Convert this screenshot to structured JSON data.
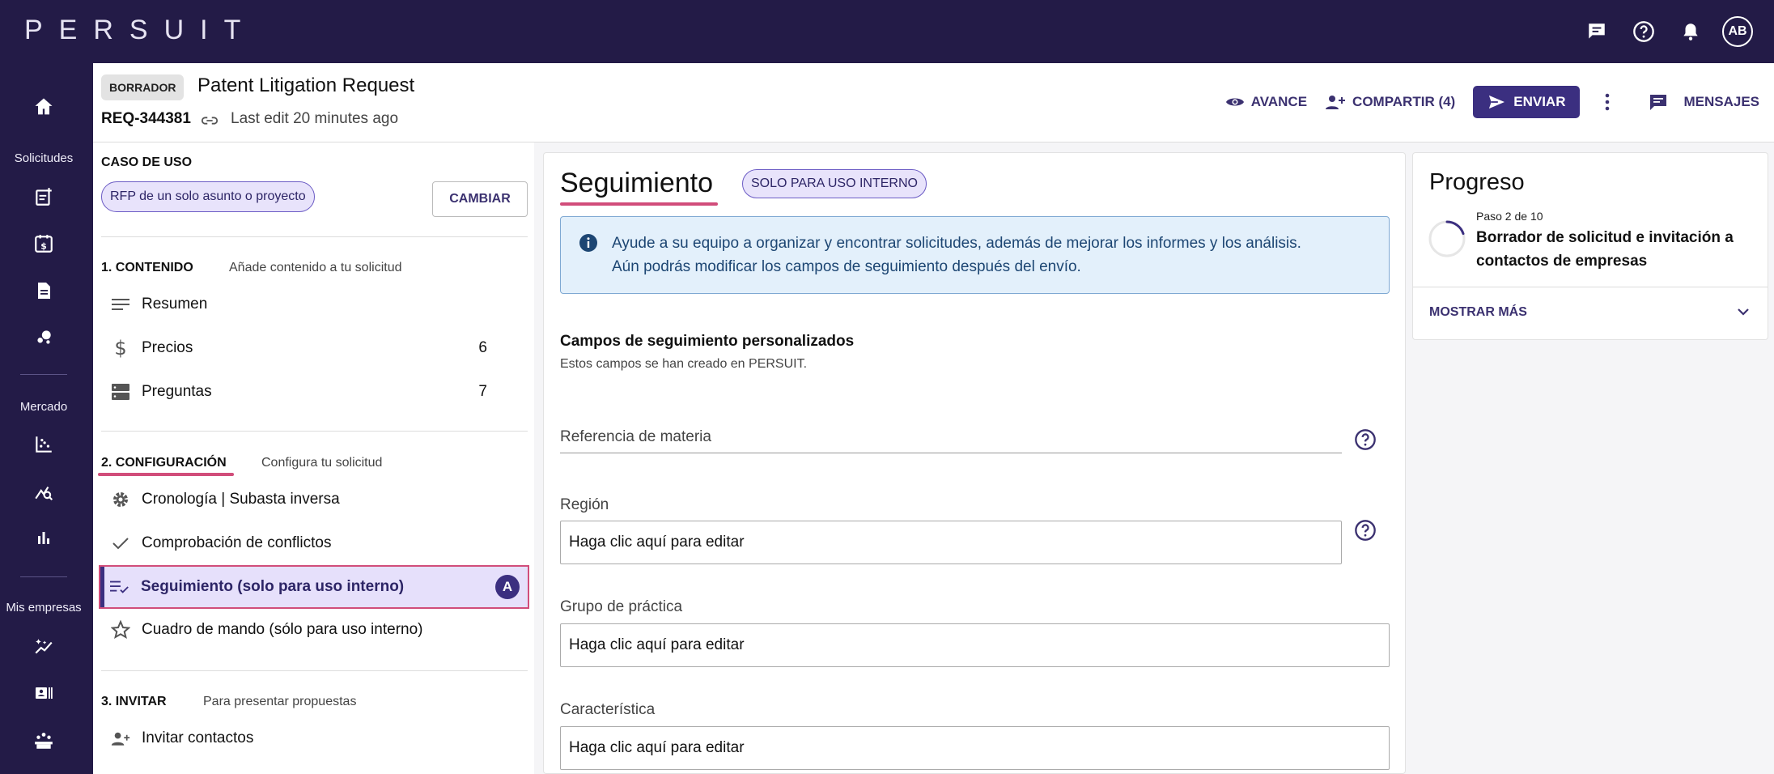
{
  "app": {
    "logo": "PERSUIT",
    "avatar_initials": "AB"
  },
  "sidebar": {
    "section_solicitudes": "Solicitudes",
    "section_mercado": "Mercado",
    "section_mis_empresas": "Mis empresas"
  },
  "header": {
    "status_badge": "BORRADOR",
    "title": "Patent Litigation Request",
    "request_id": "REQ-344381",
    "last_edit": "Last edit 20 minutes ago",
    "preview_label": "AVANCE",
    "share_label": "COMPARTIR (4)",
    "send_label": "ENVIAR",
    "messages_label": "MENSAJES"
  },
  "left": {
    "use_case_heading": "CASO DE USO",
    "use_case_value": "RFP de un solo asunto o proyecto",
    "change_label": "CAMBIAR",
    "s1_heading": "1. CONTENIDO",
    "s1_sub": "Añade contenido a tu solicitud",
    "s1_items": [
      {
        "label": "Resumen",
        "count": ""
      },
      {
        "label": "Precios",
        "count": "6"
      },
      {
        "label": "Preguntas",
        "count": "7"
      }
    ],
    "s2_heading": "2. CONFIGURACIÓN",
    "s2_sub": "Configura tu solicitud",
    "s2_items": [
      {
        "label": "Cronología | Subasta inversa"
      },
      {
        "label": "Comprobación de conflictos"
      },
      {
        "label": "Seguimiento (solo para uso interno)",
        "badge": "A"
      },
      {
        "label": "Cuadro de mando (sólo para uso interno)"
      }
    ],
    "s3_heading": "3. INVITAR",
    "s3_sub": "Para presentar propuestas",
    "s3_items": [
      {
        "label": "Invitar contactos"
      }
    ]
  },
  "main": {
    "title": "Seguimiento",
    "internal_badge": "SOLO PARA USO INTERNO",
    "info_text_1": "Ayude a su equipo a organizar y encontrar solicitudes, además de mejorar los informes y los análisis.",
    "info_text_2": "Aún podrás modificar los campos de seguimiento después del envío.",
    "custom_heading": "Campos de seguimiento personalizados",
    "custom_sub": "Estos campos se han creado en PERSUIT.",
    "fields": [
      {
        "label": "Referencia de materia",
        "value": ""
      },
      {
        "label": "Región",
        "value": "Haga clic aquí para editar"
      },
      {
        "label": "Grupo de práctica",
        "value": "Haga clic aquí para editar"
      },
      {
        "label": "Característica",
        "value": "Haga clic aquí para editar"
      }
    ]
  },
  "progress": {
    "title": "Progreso",
    "step": "Paso 2 de 10",
    "description": "Borrador de solicitud e invitación a contactos de empresas",
    "show_more": "MOSTRAR MÁS",
    "value_fraction": 0.2
  },
  "colors": {
    "brand": "#231b47",
    "accent": "#3b2f80",
    "highlight": "#d14d7a"
  }
}
